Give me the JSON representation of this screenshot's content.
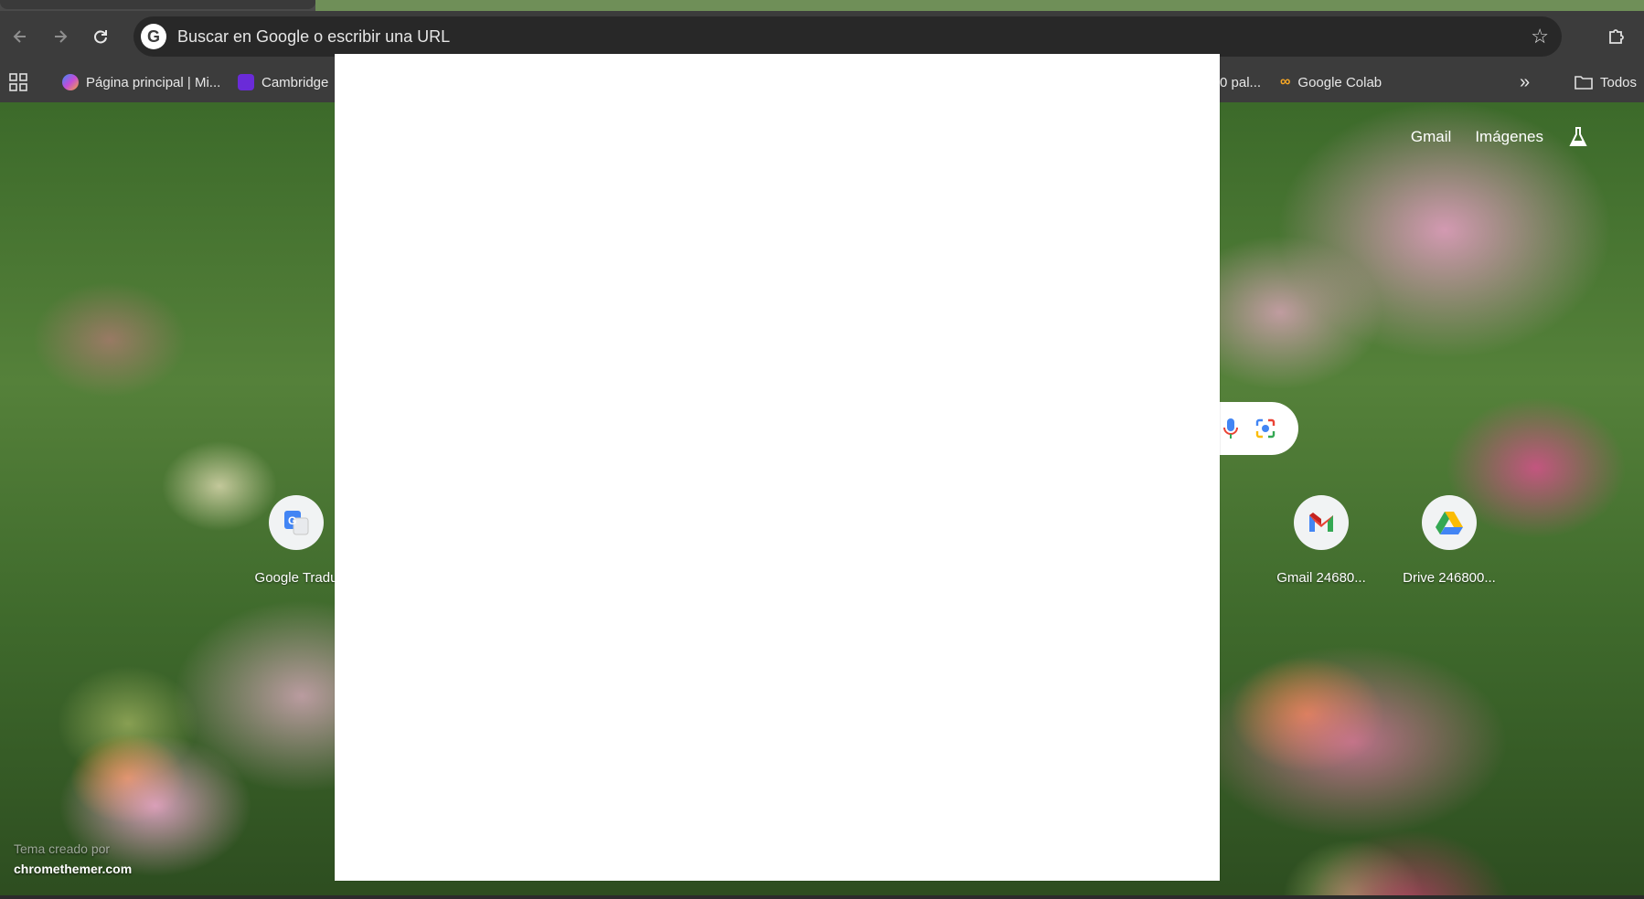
{
  "browser": {
    "omnibox": {
      "placeholder": "Buscar en Google o escribir una URL"
    },
    "bookmarks": [
      {
        "label": "Página principal | Mi...",
        "icon": "microsoft-copilot-icon"
      },
      {
        "label": "Cambridge",
        "icon": "cambridge-shield-icon"
      },
      {
        "label": "0 pal...",
        "icon": "partial-bookmark"
      },
      {
        "label": "Google Colab",
        "icon": "colab-icon"
      }
    ],
    "all_bookmarks_label": "Todos"
  },
  "newtab": {
    "links": {
      "gmail": "Gmail",
      "images": "Imágenes"
    },
    "shortcuts": [
      {
        "label": "Google Tradu",
        "icon": "google-translate-icon"
      },
      {
        "label": "Gmail 24680...",
        "icon": "gmail-icon"
      },
      {
        "label": "Drive 246800...",
        "icon": "google-drive-icon"
      }
    ],
    "credit": {
      "line1": "Tema creado por",
      "line2": "chromethemer.com"
    }
  },
  "colors": {
    "toolbar": "#3c3c3c",
    "omnibox": "#282828",
    "overlay": "#ffffff"
  }
}
